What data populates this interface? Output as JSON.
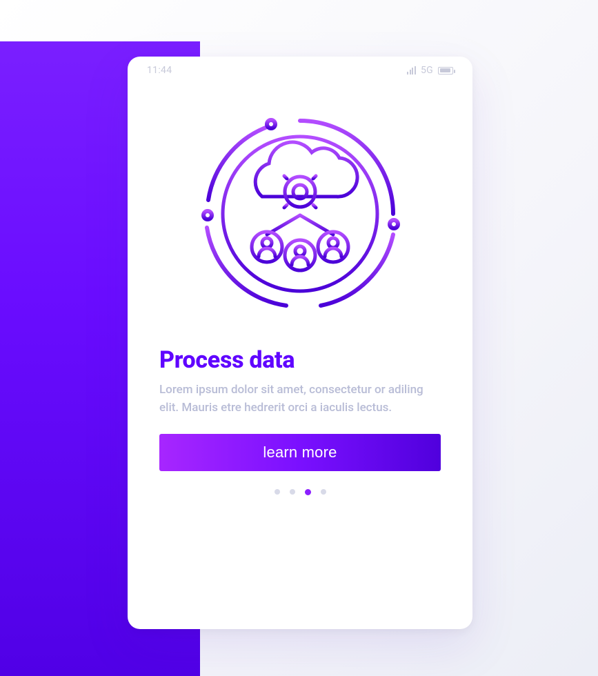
{
  "statusbar": {
    "time": "11:44",
    "network": "5G"
  },
  "illustration": {
    "name": "cloud-process-users-icon"
  },
  "content": {
    "title": "Process data",
    "body": "Lorem ipsum dolor sit amet, consectetur or adiling elit. Mauris etre hedrerit orci a iaculis lectus."
  },
  "cta": {
    "label": "learn more"
  },
  "pagination": {
    "count": 4,
    "active_index": 2
  },
  "colors": {
    "accent": "#6a0dff",
    "muted_text": "#b8bcd6"
  }
}
